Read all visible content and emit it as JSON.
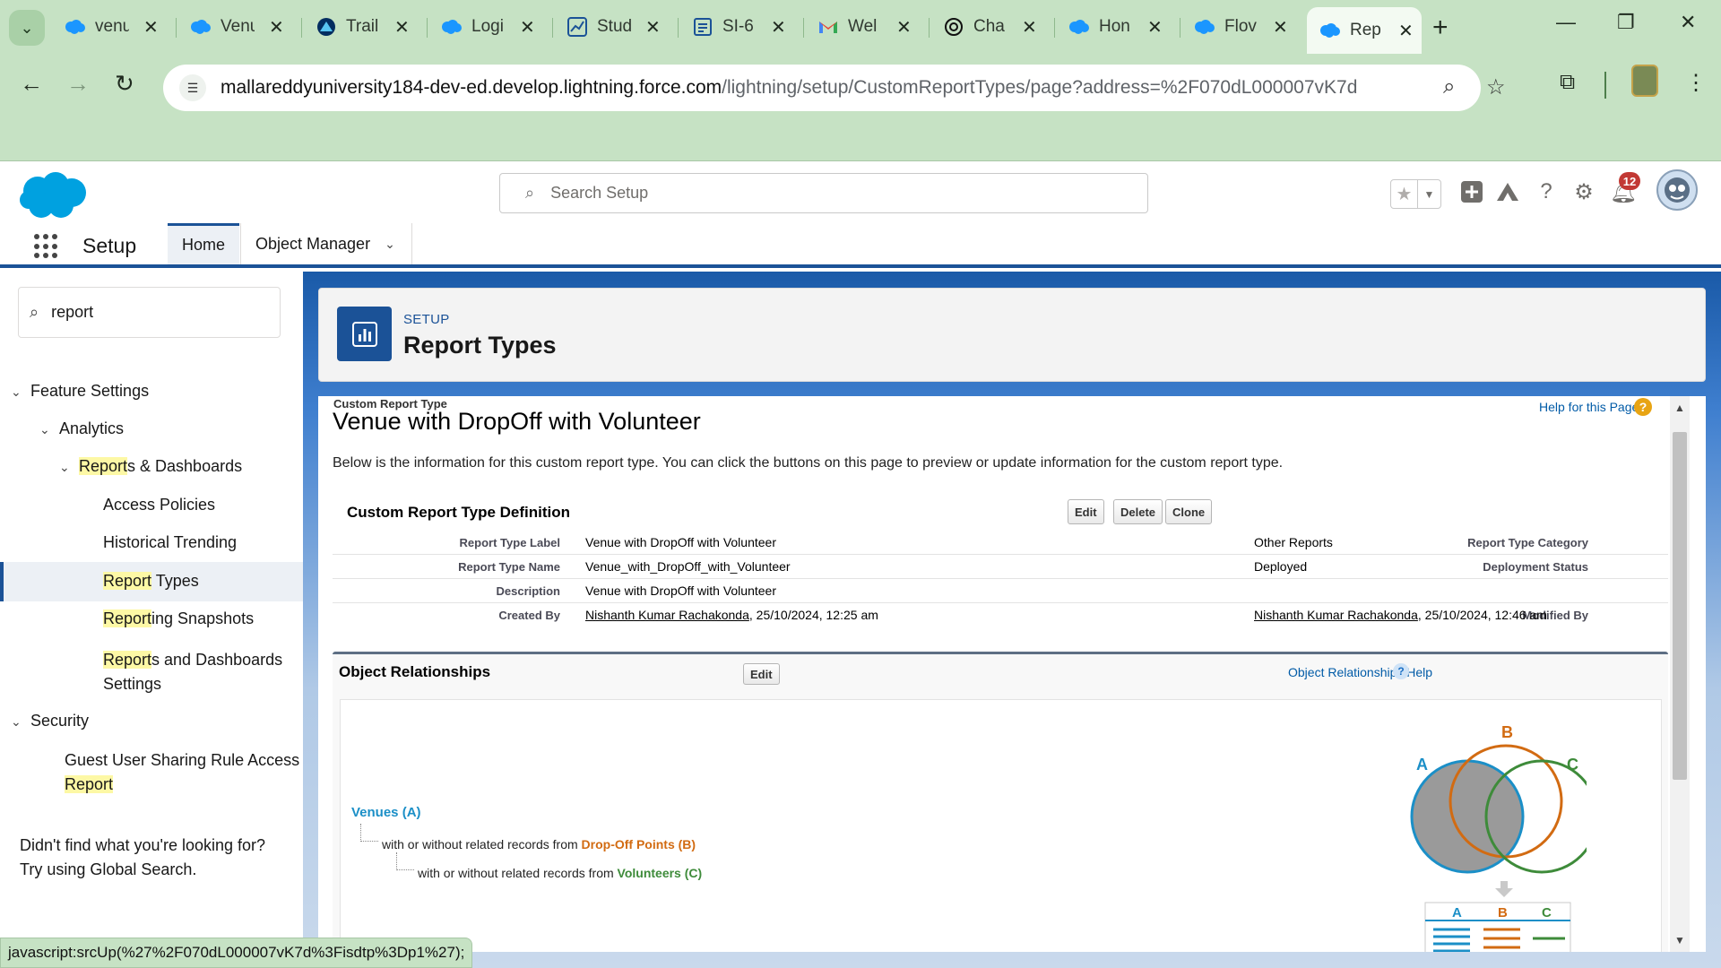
{
  "browser": {
    "tabs": [
      {
        "title": "venu",
        "icon": "salesforce-cloud-icon"
      },
      {
        "title": "Venu",
        "icon": "salesforce-cloud-icon"
      },
      {
        "title": "Trail",
        "icon": "trailhead-icon"
      },
      {
        "title": "Logi",
        "icon": "salesforce-cloud-icon"
      },
      {
        "title": "Stud",
        "icon": "chart-icon"
      },
      {
        "title": "SI-6",
        "icon": "document-icon"
      },
      {
        "title": "Wel",
        "icon": "gmail-icon"
      },
      {
        "title": "Cha",
        "icon": "chatgpt-icon"
      },
      {
        "title": "Hon",
        "icon": "salesforce-cloud-icon"
      },
      {
        "title": "Flov",
        "icon": "salesforce-cloud-icon"
      },
      {
        "title": "Rep",
        "icon": "salesforce-cloud-icon",
        "active": true
      }
    ],
    "url_host": "mallareddyuniversity184-dev-ed.develop.lightning.force.com",
    "url_path": "/lightning/setup/CustomReportTypes/page?address=%2F070dL000007vK7d",
    "status_text": "javascript:srcUp(%27%2F070dL000007vK7d%3Fisdtp%3Dp1%27);"
  },
  "header": {
    "search_placeholder": "Search Setup",
    "notification_count": "12"
  },
  "nav": {
    "app_name": "Setup",
    "tabs": [
      "Home",
      "Object Manager"
    ]
  },
  "sidebar": {
    "quick_find_value": "report",
    "items": [
      {
        "label": "Feature Settings"
      },
      {
        "label": "Analytics"
      },
      {
        "label_hl": "Report",
        "label_rest": "s & Dashboards"
      },
      {
        "label": "Access Policies"
      },
      {
        "label": "Historical Trending"
      },
      {
        "label_hl": "Report",
        "label_rest": " Types"
      },
      {
        "label_hl": "Report",
        "label_rest": "ing Snapshots"
      },
      {
        "label_hl": "Report",
        "label_rest": "s and Dashboards",
        "label_line2": "Settings"
      },
      {
        "label": "Security"
      },
      {
        "label": "Guest User Sharing Rule Access",
        "label_line2_hl": "Report"
      }
    ],
    "footer_line1": "Didn't find what you're looking for?",
    "footer_line2": "Try using Global Search."
  },
  "page_header": {
    "kicker": "SETUP",
    "title": "Report Types"
  },
  "crt": {
    "kicker": "Custom Report Type",
    "title": "Venue with DropOff with Volunteer",
    "help_link": "Help for this Page",
    "description": "Below is the information for this custom report type. You can click the buttons on this page to preview or update information for the custom report type.",
    "definition": {
      "title": "Custom Report Type Definition",
      "buttons": [
        "Edit",
        "Delete",
        "Clone"
      ],
      "fields": {
        "report_type_label_lbl": "Report Type Label",
        "report_type_label": "Venue with DropOff with Volunteer",
        "report_type_category_lbl": "Report Type Category",
        "report_type_category": "Other Reports",
        "report_type_name_lbl": "Report Type Name",
        "report_type_name": "Venue_with_DropOff_with_Volunteer",
        "deployment_status_lbl": "Deployment Status",
        "deployment_status": "Deployed",
        "description_lbl": "Description",
        "description": "Venue with DropOff with Volunteer",
        "created_by_lbl": "Created By",
        "created_by_name": "Nishanth Kumar Rachakonda",
        "created_by_date": ", 25/10/2024, 12:25 am",
        "modified_by_lbl": "Modified By",
        "modified_by_name": "Nishanth Kumar Rachakonda",
        "modified_by_date": ", 25/10/2024, 12:46 am"
      }
    },
    "relationships": {
      "title": "Object Relationships",
      "edit": "Edit",
      "help": "Object Relationships Help",
      "a_label": "Venues (A)",
      "b_prefix": "with or without related records from ",
      "b_object": "Drop-Off Points (B)",
      "c_prefix": "with or without related records from ",
      "c_object": "Volunteers (C)",
      "venn": {
        "a": "A",
        "b": "B",
        "c": "C"
      },
      "colors": {
        "a": "#1b8fc7",
        "b": "#d26b12",
        "c": "#3e8b3a"
      }
    }
  }
}
